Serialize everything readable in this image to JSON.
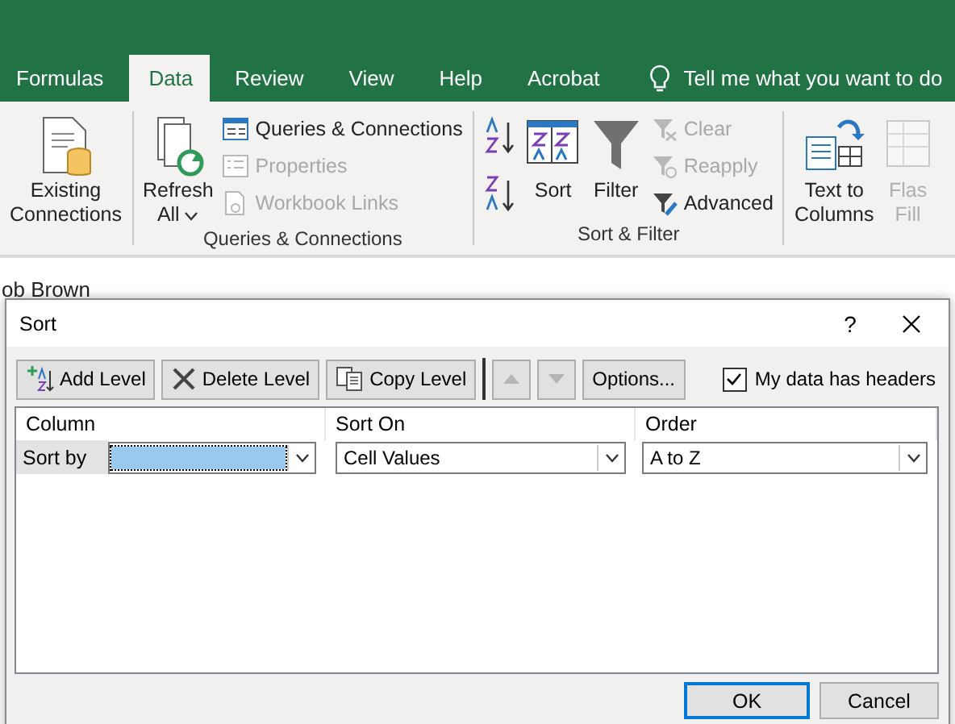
{
  "ribbon_tabs": [
    {
      "label": "Formulas",
      "selected": false
    },
    {
      "label": "Data",
      "selected": true
    },
    {
      "label": "Review",
      "selected": false
    },
    {
      "label": "View",
      "selected": false
    },
    {
      "label": "Help",
      "selected": false
    },
    {
      "label": "Acrobat",
      "selected": false
    }
  ],
  "tell_me": "Tell me what you want to do",
  "ribbon_groups": [
    {
      "items": [
        {
          "kind": "large",
          "lines": [
            "Existing",
            "Connections"
          ],
          "disabled": false
        }
      ]
    },
    {
      "label": "Queries & Connections",
      "items": [
        {
          "kind": "large",
          "lines": [
            "Refresh",
            "All"
          ],
          "disabled": false,
          "dropdown": true
        },
        {
          "kind": "small",
          "text": "Queries & Connections",
          "disabled": false
        },
        {
          "kind": "small",
          "text": "Properties",
          "disabled": true
        },
        {
          "kind": "small",
          "text": "Workbook Links",
          "disabled": true
        }
      ]
    },
    {
      "label": "Sort & Filter",
      "items": [
        {
          "kind": "icon"
        },
        {
          "kind": "icon"
        },
        {
          "kind": "large",
          "lines": [
            "Sort"
          ],
          "disabled": false
        },
        {
          "kind": "large",
          "lines": [
            "Filter"
          ],
          "disabled": false
        },
        {
          "kind": "small",
          "text": "Clear",
          "disabled": true
        },
        {
          "kind": "small",
          "text": "Reapply",
          "disabled": true
        },
        {
          "kind": "small",
          "text": "Advanced",
          "disabled": false
        }
      ]
    },
    {
      "items": [
        {
          "kind": "large",
          "lines": [
            "Text to",
            "Columns"
          ],
          "disabled": false
        },
        {
          "kind": "large",
          "lines": [
            "Flas",
            "Fill"
          ],
          "disabled": true
        }
      ]
    }
  ],
  "sheet_text": "ob Brown",
  "dialog": {
    "title": "Sort",
    "help": "?",
    "toolbar": [
      {
        "kind": "add",
        "label": "Add Level"
      },
      {
        "kind": "delete",
        "label": "Delete Level"
      },
      {
        "kind": "copy",
        "label": "Copy Level"
      },
      {
        "kind": "up",
        "disabled": true
      },
      {
        "kind": "down",
        "disabled": true
      },
      {
        "kind": "options",
        "label": "Options..."
      }
    ],
    "headers_checkbox": {
      "label": "My data has headers",
      "checked": true
    },
    "columns": [
      "Column",
      "Sort On",
      "Order"
    ],
    "rows": [
      {
        "label": "Sort by",
        "selected": true,
        "sort_on": "Cell Values",
        "order": "A to Z"
      }
    ],
    "buttons": [
      {
        "label": "OK",
        "default": true
      },
      {
        "label": "Cancel",
        "default": false
      }
    ]
  }
}
